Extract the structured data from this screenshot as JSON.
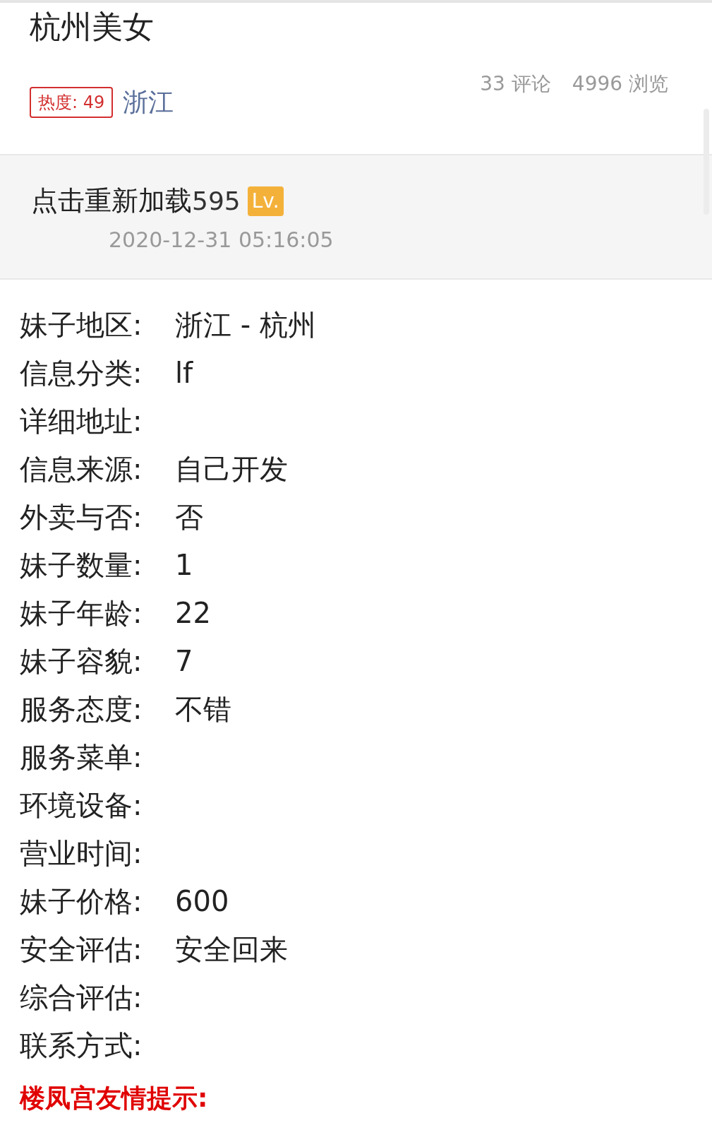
{
  "title": "杭州美女",
  "heat_badge": "热度: 49",
  "region_link": "浙江",
  "stats": [
    "33 评论",
    "4996 浏览"
  ],
  "post": {
    "reload_text": "点击重新加载",
    "username_tail": "595",
    "level_badge": "Lv.",
    "time": "2020-12-31 05:16:05"
  },
  "fields": [
    {
      "label": "妹子地区:",
      "value": "浙江 - 杭州"
    },
    {
      "label": "信息分类:",
      "value": "lf"
    },
    {
      "label": "详细地址:"
    },
    {
      "label": "信息来源:",
      "value": "自己开发"
    },
    {
      "label": "外卖与否:",
      "value": "否"
    },
    {
      "label": "妹子数量:",
      "value": "1"
    },
    {
      "label": "妹子年龄:",
      "value": "22"
    },
    {
      "label": "妹子容貌:",
      "value": "7"
    },
    {
      "label": "服务态度:",
      "value": "不错"
    },
    {
      "label": "服务菜单:"
    },
    {
      "label": "环境设备:"
    },
    {
      "label": "营业时间:"
    },
    {
      "label": "妹子价格:",
      "value": "600"
    },
    {
      "label": "安全评估:",
      "value": "安全回来"
    },
    {
      "label": "综合评估:"
    },
    {
      "label": "联系方式:"
    }
  ],
  "notice": "楼凤宫友情提示:"
}
